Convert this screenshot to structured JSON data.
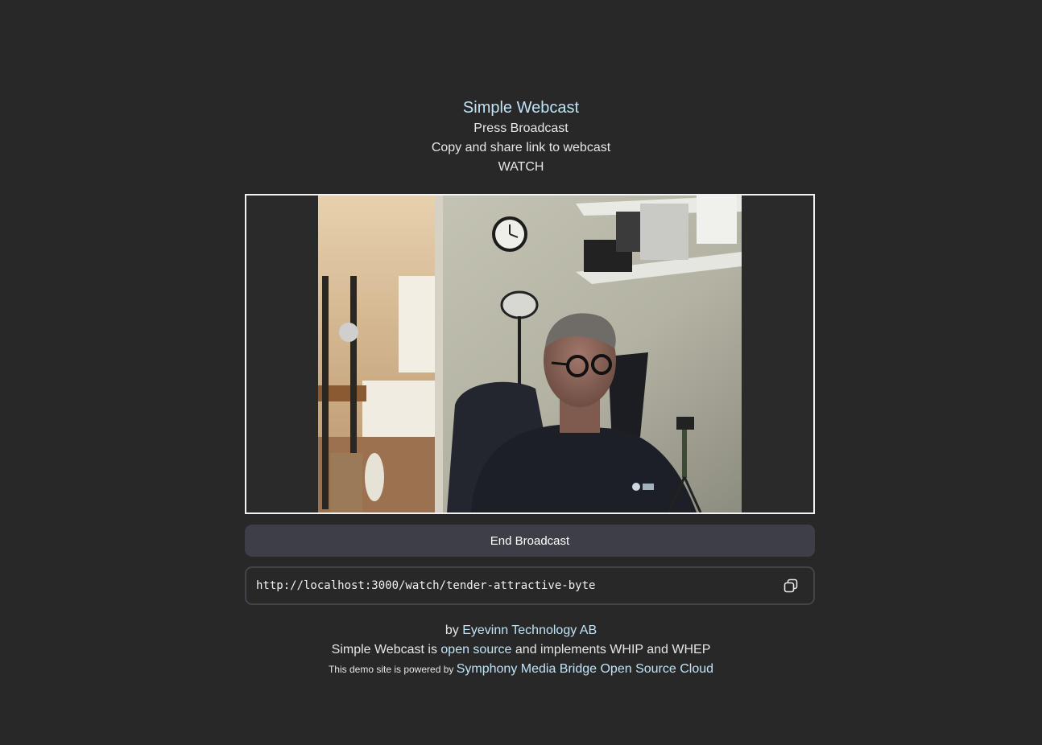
{
  "header": {
    "title": "Simple Webcast",
    "line1": "Press Broadcast",
    "line2": "Copy and share link to webcast",
    "line3": "WATCH"
  },
  "controls": {
    "end_broadcast_label": "End Broadcast",
    "watch_url": "http://localhost:3000/watch/tender-attractive-byte",
    "copy_icon": "copy-icon"
  },
  "footer": {
    "by_prefix": "by ",
    "company": "Eyevinn Technology AB",
    "line2_prefix": "Simple Webcast is ",
    "open_source": "open source",
    "line2_suffix": " and implements WHIP and WHEP",
    "line3_prefix": "This demo site is powered by ",
    "smb": "Symphony Media Bridge",
    "osc": "Open Source Cloud"
  },
  "colors": {
    "background": "#282828",
    "link": "#bfe3f7",
    "button": "#3e3f46"
  }
}
